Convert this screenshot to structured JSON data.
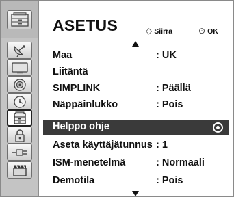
{
  "menu": {
    "title": "ASETUS",
    "hints": {
      "move_label": "Siirrä",
      "move_icon": "dpad-icon",
      "ok_label": "OK",
      "ok_icon": "ok-button-icon"
    }
  },
  "categories": [
    {
      "name": "picture",
      "icon": "satellite-dish-icon"
    },
    {
      "name": "screen",
      "icon": "tv-screen-icon"
    },
    {
      "name": "sound",
      "icon": "speaker-icon"
    },
    {
      "name": "time",
      "icon": "clock-icon"
    },
    {
      "name": "setup",
      "icon": "settings-cabinet-icon",
      "active": true
    },
    {
      "name": "lock",
      "icon": "lock-icon"
    },
    {
      "name": "input",
      "icon": "plug-icon"
    },
    {
      "name": "media",
      "icon": "clapperboard-icon"
    }
  ],
  "settings": [
    {
      "label": "Maa",
      "value": ": UK"
    },
    {
      "label": "Liitäntä",
      "value": ""
    },
    {
      "label": "SIMPLINK",
      "value": ": Päällä"
    },
    {
      "label": "Näppäinlukko",
      "value": ": Pois"
    },
    {
      "label": "Helppo ohje",
      "value": "",
      "selected": true
    },
    {
      "label": "Aseta käyttäjätunnus",
      "value": ": 1"
    },
    {
      "label": "ISM-menetelmä",
      "value": ": Normaali"
    },
    {
      "label": "Demotila",
      "value": ": Pois"
    }
  ],
  "colors": {
    "highlight": "#3a3a3a",
    "sidebar": "#c4c4c4",
    "text": "#111111"
  }
}
